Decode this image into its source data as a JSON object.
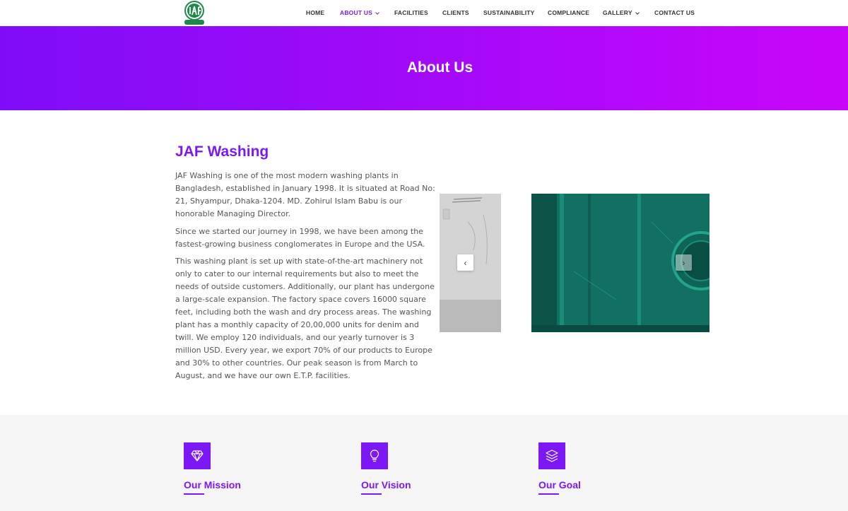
{
  "header": {
    "logo_alt": "JAF Washing",
    "logo_text": "Washing",
    "nav": [
      {
        "label": "HOME"
      },
      {
        "label": "ABOUT US"
      },
      {
        "label": "FACILITIES"
      },
      {
        "label": "CLIENTS"
      },
      {
        "label": "SUSTAINABILITY"
      },
      {
        "label": "COMPLIANCE"
      },
      {
        "label": "GALLERY"
      },
      {
        "label": "CONTACT US"
      }
    ]
  },
  "hero": {
    "title": "About Us"
  },
  "about": {
    "title": "JAF Washing",
    "paragraphs": [
      "JAF Washing is one of the most modern washing plants in Bangladesh, established in January 1998. It is situated at Road No: 21, Shyampur, Dhaka-1204. MD. Zohirul Islam Babu is our honorable Managing Director.",
      "Since we started our journey in 1998, we have been among the fastest-growing business conglomerates in Europe and the USA.",
      "This washing plant is set up with state-of-the-art machinery not only to cater to our internal requirements but also to meet the needs of outside customers. Additionally, our plant has undergone a large-scale expansion. The factory space covers 16000 square feet, including both the wash and dry process areas. The washing plant has a monthly capacity of 20,00,000 units for denim and twill. We employ 120 individuals, and our yearly turnover is 3 million USD. Every year, we export 70% of our products to Europe and 30% to other countries. Our peak season is from March to August, and we have our own E.T.P. facilities."
    ]
  },
  "carousel": {
    "prev_symbol": "‹",
    "next_symbol": "›"
  },
  "features": [
    {
      "title": "Our Mission",
      "icon": "diamond-icon"
    },
    {
      "title": "Our Vision",
      "icon": "lightbulb-icon"
    },
    {
      "title": "Our Goal",
      "icon": "layers-icon"
    }
  ],
  "colors": {
    "accent": "#7b18f5",
    "hero_start": "#7f0cf8",
    "hero_end": "#c905fb"
  }
}
